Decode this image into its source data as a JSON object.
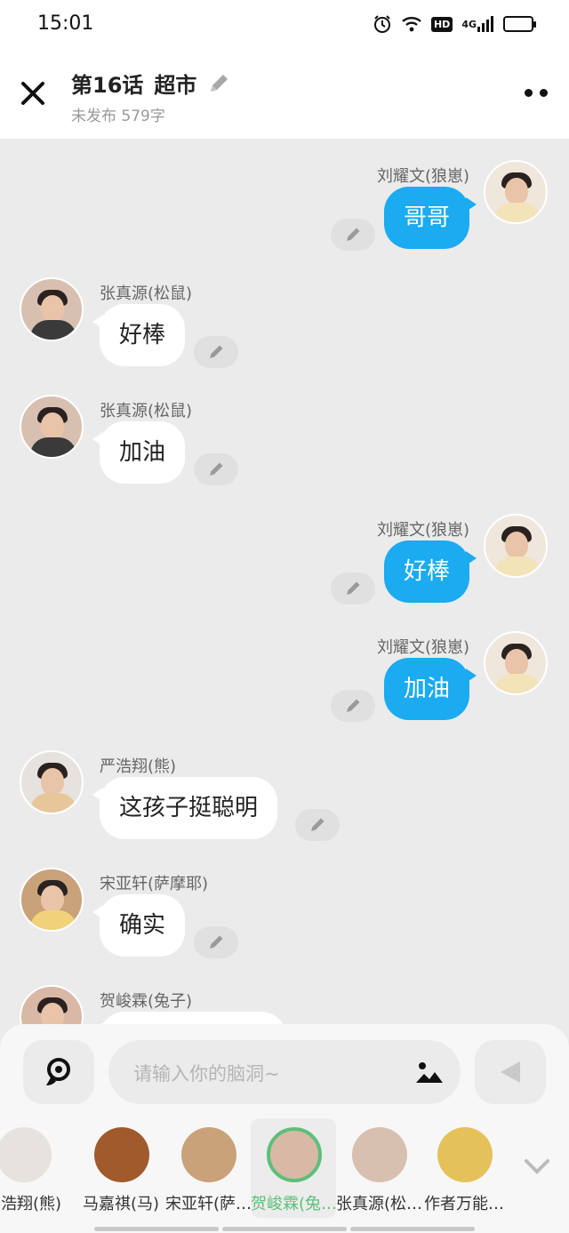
{
  "status_bar": {
    "time": "15:01",
    "hd": "HD",
    "network": "4G"
  },
  "header": {
    "episode": "第16话",
    "chapter_title": "超市",
    "subtitle": "未发布 579字"
  },
  "messages": [
    {
      "side": "right",
      "sender": "刘耀文(狼崽)",
      "text": "哥哥"
    },
    {
      "side": "left",
      "sender": "张真源(松鼠)",
      "text": "好棒"
    },
    {
      "side": "left",
      "sender": "张真源(松鼠)",
      "text": "加油"
    },
    {
      "side": "right",
      "sender": "刘耀文(狼崽)",
      "text": "好棒"
    },
    {
      "side": "right",
      "sender": "刘耀文(狼崽)",
      "text": "加油"
    },
    {
      "side": "left",
      "sender": "严浩翔(熊)",
      "text": "这孩子挺聪明"
    },
    {
      "side": "left",
      "sender": "宋亚轩(萨摩耶)",
      "text": "确实"
    },
    {
      "side": "left",
      "sender": "贺峻霖(兔子)",
      "text": ""
    }
  ],
  "composer": {
    "placeholder": "请输入你的脑洞~"
  },
  "roles": [
    {
      "name": "严浩翔(熊)"
    },
    {
      "name": "马嘉祺(马)"
    },
    {
      "name": "宋亚轩(萨…"
    },
    {
      "name": "贺峻霖(兔…",
      "active": true
    },
    {
      "name": "张真源(松…"
    },
    {
      "name": "作者万能…"
    }
  ],
  "colors": {
    "accent_blue": "#1aabf0",
    "active_green": "#5cbf7a",
    "background": "#ebebeb"
  }
}
